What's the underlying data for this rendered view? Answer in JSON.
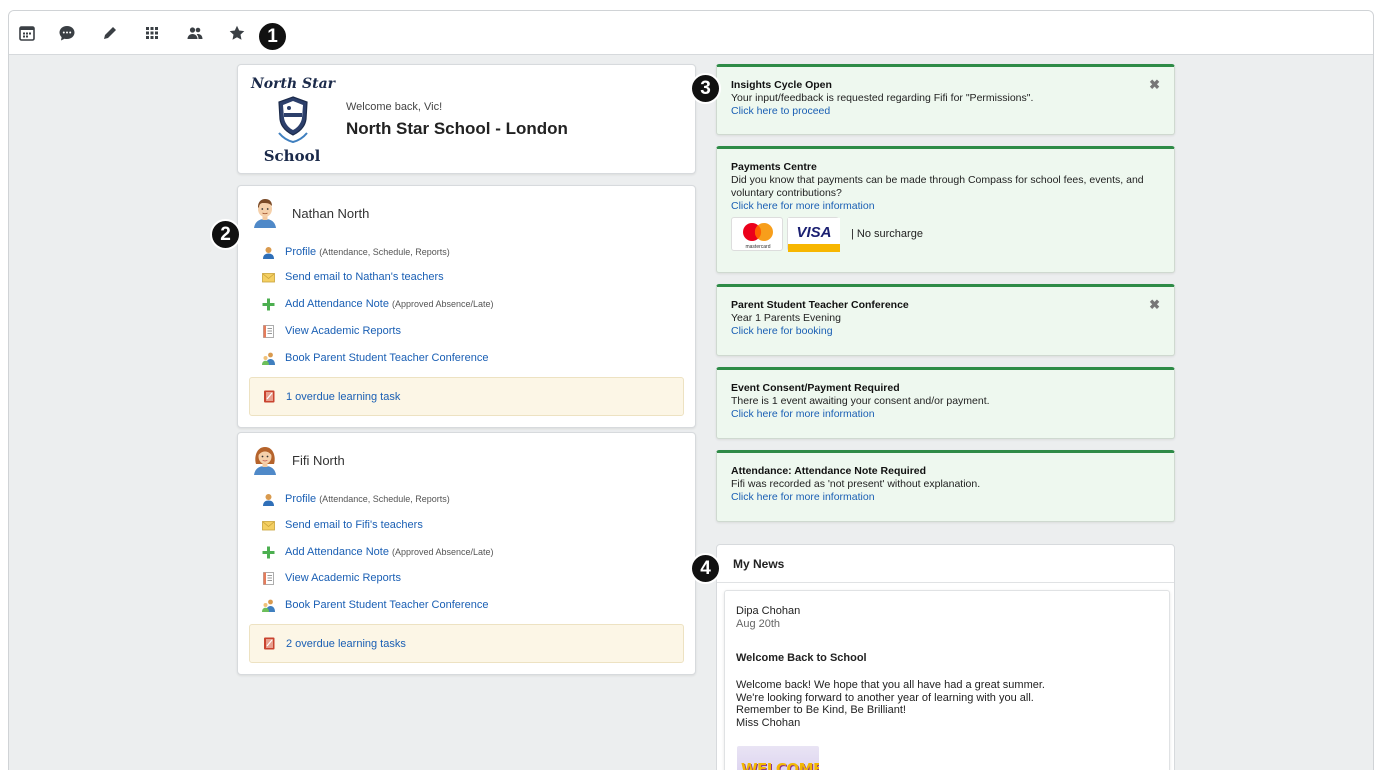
{
  "toolbar": {
    "icons": [
      "calendar-icon",
      "chat-icon",
      "pencil-icon",
      "grid-icon",
      "people-icon",
      "star-icon"
    ]
  },
  "callouts": [
    "1",
    "2",
    "3",
    "4"
  ],
  "school": {
    "logo_top": "North Star",
    "logo_bottom": "School",
    "welcome": "Welcome back, Vic!",
    "name": "North Star School - London"
  },
  "students": [
    {
      "name": "Nathan North",
      "profile_label": "Profile",
      "profile_note": "(Attendance, Schedule, Reports)",
      "email_label": "Send email to Nathan's teachers",
      "attendance_label": "Add Attendance Note",
      "attendance_note": "(Approved Absence/Late)",
      "reports_label": "View Academic Reports",
      "conference_label": "Book Parent Student Teacher Conference",
      "tasks_label": "1 overdue learning task"
    },
    {
      "name": "Fifi North",
      "profile_label": "Profile",
      "profile_note": "(Attendance, Schedule, Reports)",
      "email_label": "Send email to Fifi's teachers",
      "attendance_label": "Add Attendance Note",
      "attendance_note": "(Approved Absence/Late)",
      "reports_label": "View Academic Reports",
      "conference_label": "Book Parent Student Teacher Conference",
      "tasks_label": "2 overdue learning tasks"
    }
  ],
  "notices": [
    {
      "title": "Insights Cycle Open",
      "text": "Your input/feedback is requested regarding Fifi for \"Permissions\".",
      "link": "Click here to proceed",
      "closable": true
    },
    {
      "title": "Payments Centre",
      "text": "Did you know that payments can be made through Compass for school fees, events, and voluntary contributions?",
      "link": "Click here for more information",
      "mastercard_label": "mastercard",
      "visa_label": "VISA",
      "surcharge": "| No surcharge"
    },
    {
      "title": "Parent Student Teacher Conference",
      "text": "Year 1 Parents Evening",
      "link": "Click here for booking",
      "closable": true
    },
    {
      "title": "Event Consent/Payment Required",
      "text": "There is 1 event awaiting your consent and/or payment.",
      "link": "Click here for more information"
    },
    {
      "title": "Attendance: Attendance Note Required",
      "text": "Fifi was recorded as 'not present' without explanation.",
      "link": "Click here for more information"
    }
  ],
  "news": {
    "header": "My News",
    "author": "Dipa Chohan",
    "date": "Aug 20th",
    "title": "Welcome Back to School",
    "body_lines": [
      "Welcome back! We hope that you all have had a great summer.",
      "We're looking forward to another year of learning with you all.",
      "Remember to Be Kind, Be Brilliant!",
      "Miss Chohan"
    ],
    "image_text": "WELCOME"
  },
  "colors": {
    "accent_green": "#2e8b47",
    "link_blue": "#1a5fb4",
    "notice_bg": "#eef8ef",
    "task_bg": "#fcf6e6"
  }
}
